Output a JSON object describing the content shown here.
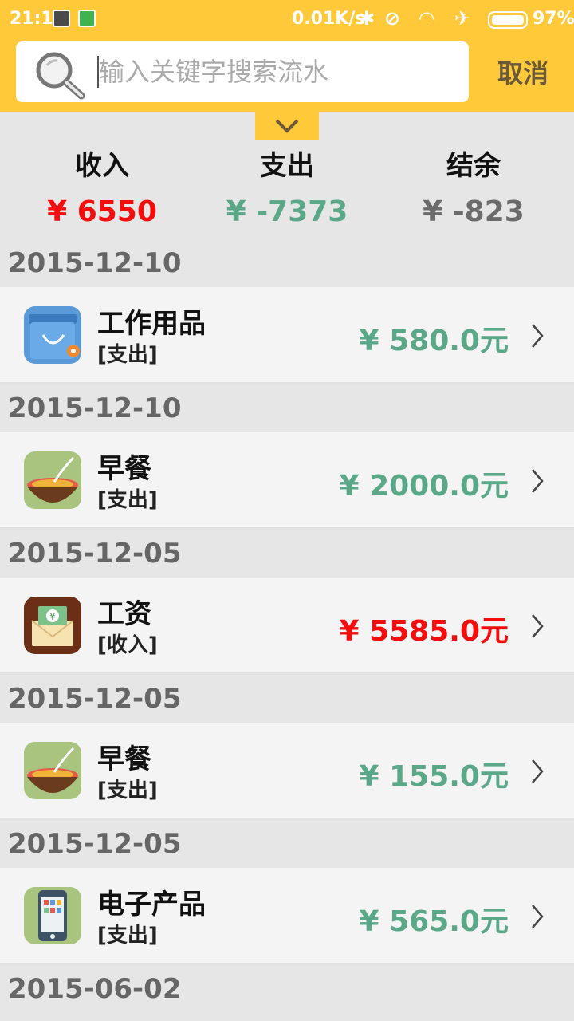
{
  "status_bar": {
    "time": "21:11",
    "net_speed": "0.01K/s",
    "battery": "97%",
    "icons": [
      "screenshot-icon",
      "camera-icon",
      "bluetooth-icon",
      "vibrate-off-icon",
      "wifi-icon",
      "airplane-icon",
      "battery-icon"
    ]
  },
  "search": {
    "placeholder": "输入关键字搜索流水",
    "value": "",
    "cancel_label": "取消"
  },
  "summary": {
    "income_label": "收入",
    "income_value": "¥ 6550",
    "expense_label": "支出",
    "expense_value": "¥ -7373",
    "balance_label": "结余",
    "balance_value": "¥ -823"
  },
  "colors": {
    "accent": "#ffc93a",
    "income": "#f50c0c",
    "expense": "#5aa888",
    "balance": "#6b6b6b"
  },
  "groups": [
    {
      "date": "2015-12-10",
      "record": {
        "title": "工作用品",
        "type": "[支出]",
        "amount": "¥ 580.0元",
        "kind": "expense",
        "icon": "shopping-bag-icon"
      }
    },
    {
      "date": "2015-12-10",
      "record": {
        "title": "早餐",
        "type": "[支出]",
        "amount": "¥ 2000.0元",
        "kind": "expense",
        "icon": "food-bowl-icon"
      }
    },
    {
      "date": "2015-12-05",
      "record": {
        "title": "工资",
        "type": "[收入]",
        "amount": "¥ 5585.0元",
        "kind": "income",
        "icon": "salary-envelope-icon"
      }
    },
    {
      "date": "2015-12-05",
      "record": {
        "title": "早餐",
        "type": "[支出]",
        "amount": "¥ 155.0元",
        "kind": "expense",
        "icon": "food-bowl-icon"
      }
    },
    {
      "date": "2015-12-05",
      "record": {
        "title": "电子产品",
        "type": "[支出]",
        "amount": "¥ 565.0元",
        "kind": "expense",
        "icon": "phone-icon"
      }
    },
    {
      "date": "2015-06-02"
    }
  ]
}
